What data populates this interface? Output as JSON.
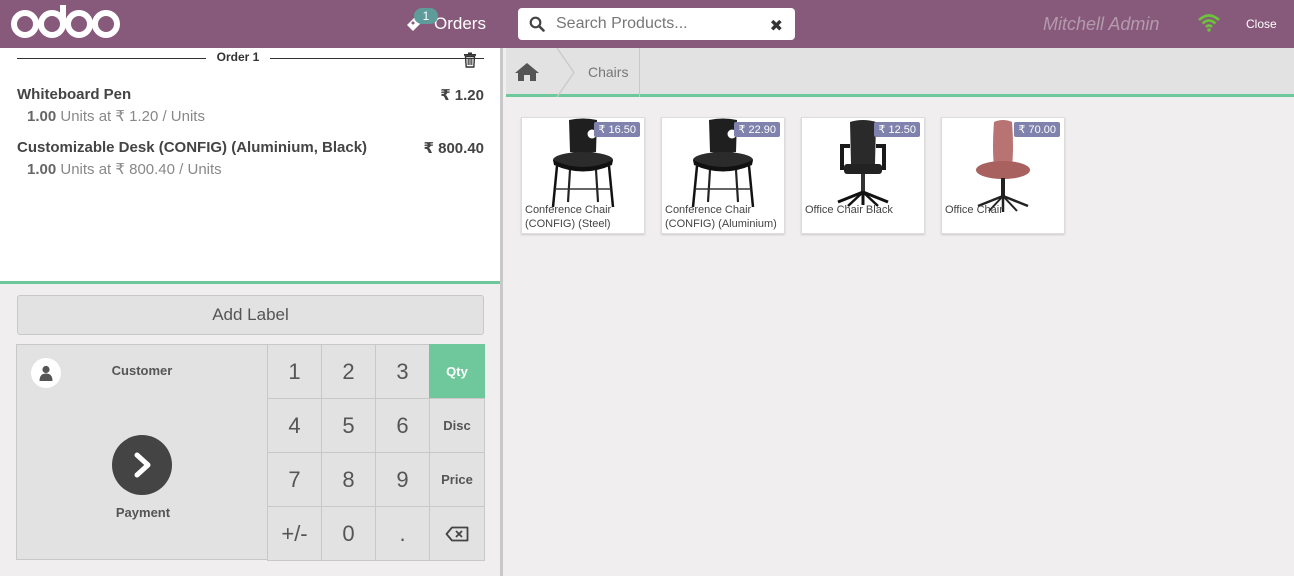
{
  "header": {
    "logo_text": "odoo",
    "orders_label": "Orders",
    "orders_count": "1",
    "search_placeholder": "Search Products...",
    "username": "Mitchell Admin",
    "close_label": "Close",
    "colors": {
      "header_bg": "#875a7b",
      "accent": "#6ec89b",
      "price_tag": "#7f82ac"
    }
  },
  "order": {
    "title": "Order 1",
    "lines": [
      {
        "name": "Whiteboard Pen",
        "price": "₹ 1.20",
        "qty": "1.00",
        "info": "Units at ₹ 1.20 / Units"
      },
      {
        "name": "Customizable Desk (CONFIG) (Aluminium, Black)",
        "price": "₹ 800.40",
        "qty": "1.00",
        "info": "Units at ₹ 800.40 / Units"
      }
    ]
  },
  "actions": {
    "add_label": "Add Label",
    "customer_label": "Customer",
    "payment_label": "Payment"
  },
  "numpad": {
    "keys": [
      "1",
      "2",
      "3",
      "Qty",
      "4",
      "5",
      "6",
      "Disc",
      "7",
      "8",
      "9",
      "Price",
      "+/-",
      "0",
      ".",
      "⌫"
    ],
    "active_mode": "Qty"
  },
  "breadcrumb": {
    "home_icon": "home-icon",
    "category": "Chairs"
  },
  "products": [
    {
      "name": "Conference Chair (CONFIG) (Steel)",
      "price": "₹ 16.50",
      "image": "black-conference-chair"
    },
    {
      "name": "Conference Chair (CONFIG) (Aluminium)",
      "price": "₹ 22.90",
      "image": "black-conference-chair"
    },
    {
      "name": "Office Chair Black",
      "price": "₹ 12.50",
      "image": "black-office-chair"
    },
    {
      "name": "Office Chair",
      "price": "₹ 70.00",
      "image": "pink-swivel-chair"
    }
  ]
}
